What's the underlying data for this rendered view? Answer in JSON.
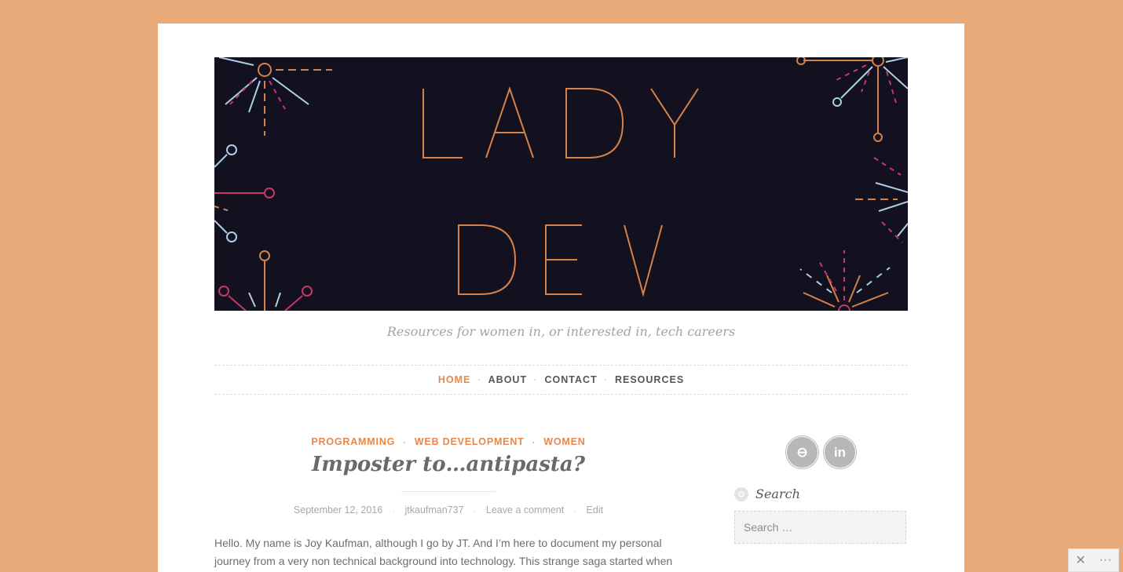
{
  "site": {
    "header_title_line1": "LADY",
    "header_title_line2": "DEV",
    "tagline": "Resources for women in, or interested in, tech careers"
  },
  "nav": {
    "items": [
      {
        "label": "HOME",
        "active": true
      },
      {
        "label": "ABOUT",
        "active": false
      },
      {
        "label": "CONTACT",
        "active": false
      },
      {
        "label": "RESOURCES",
        "active": false
      }
    ],
    "separator": "·"
  },
  "post": {
    "categories": [
      "PROGRAMMING",
      "WEB DEVELOPMENT",
      "WOMEN"
    ],
    "title": "Imposter to…antipasta?",
    "meta": {
      "date": "September 12, 2016",
      "author": "jtkaufman737",
      "comments": "Leave a comment",
      "edit": "Edit"
    },
    "excerpt_line1": "Hello. My name is Joy Kaufman, although I go by JT. And I’m here to document my personal",
    "excerpt_line2": "journey from a very non technical background into technology. This strange saga started when"
  },
  "sidebar": {
    "social": [
      {
        "icon": "github-icon",
        "glyph": "⊖"
      },
      {
        "icon": "linkedin-icon",
        "glyph": "in"
      }
    ],
    "search_widget": {
      "title": "Search",
      "placeholder": "Search …"
    }
  },
  "admin_bar": {
    "glyph_tools": "✕",
    "glyph_more": "···"
  },
  "colors": {
    "background": "#e8aa78",
    "accent": "#e8884a",
    "header_bg": "#13101f"
  }
}
